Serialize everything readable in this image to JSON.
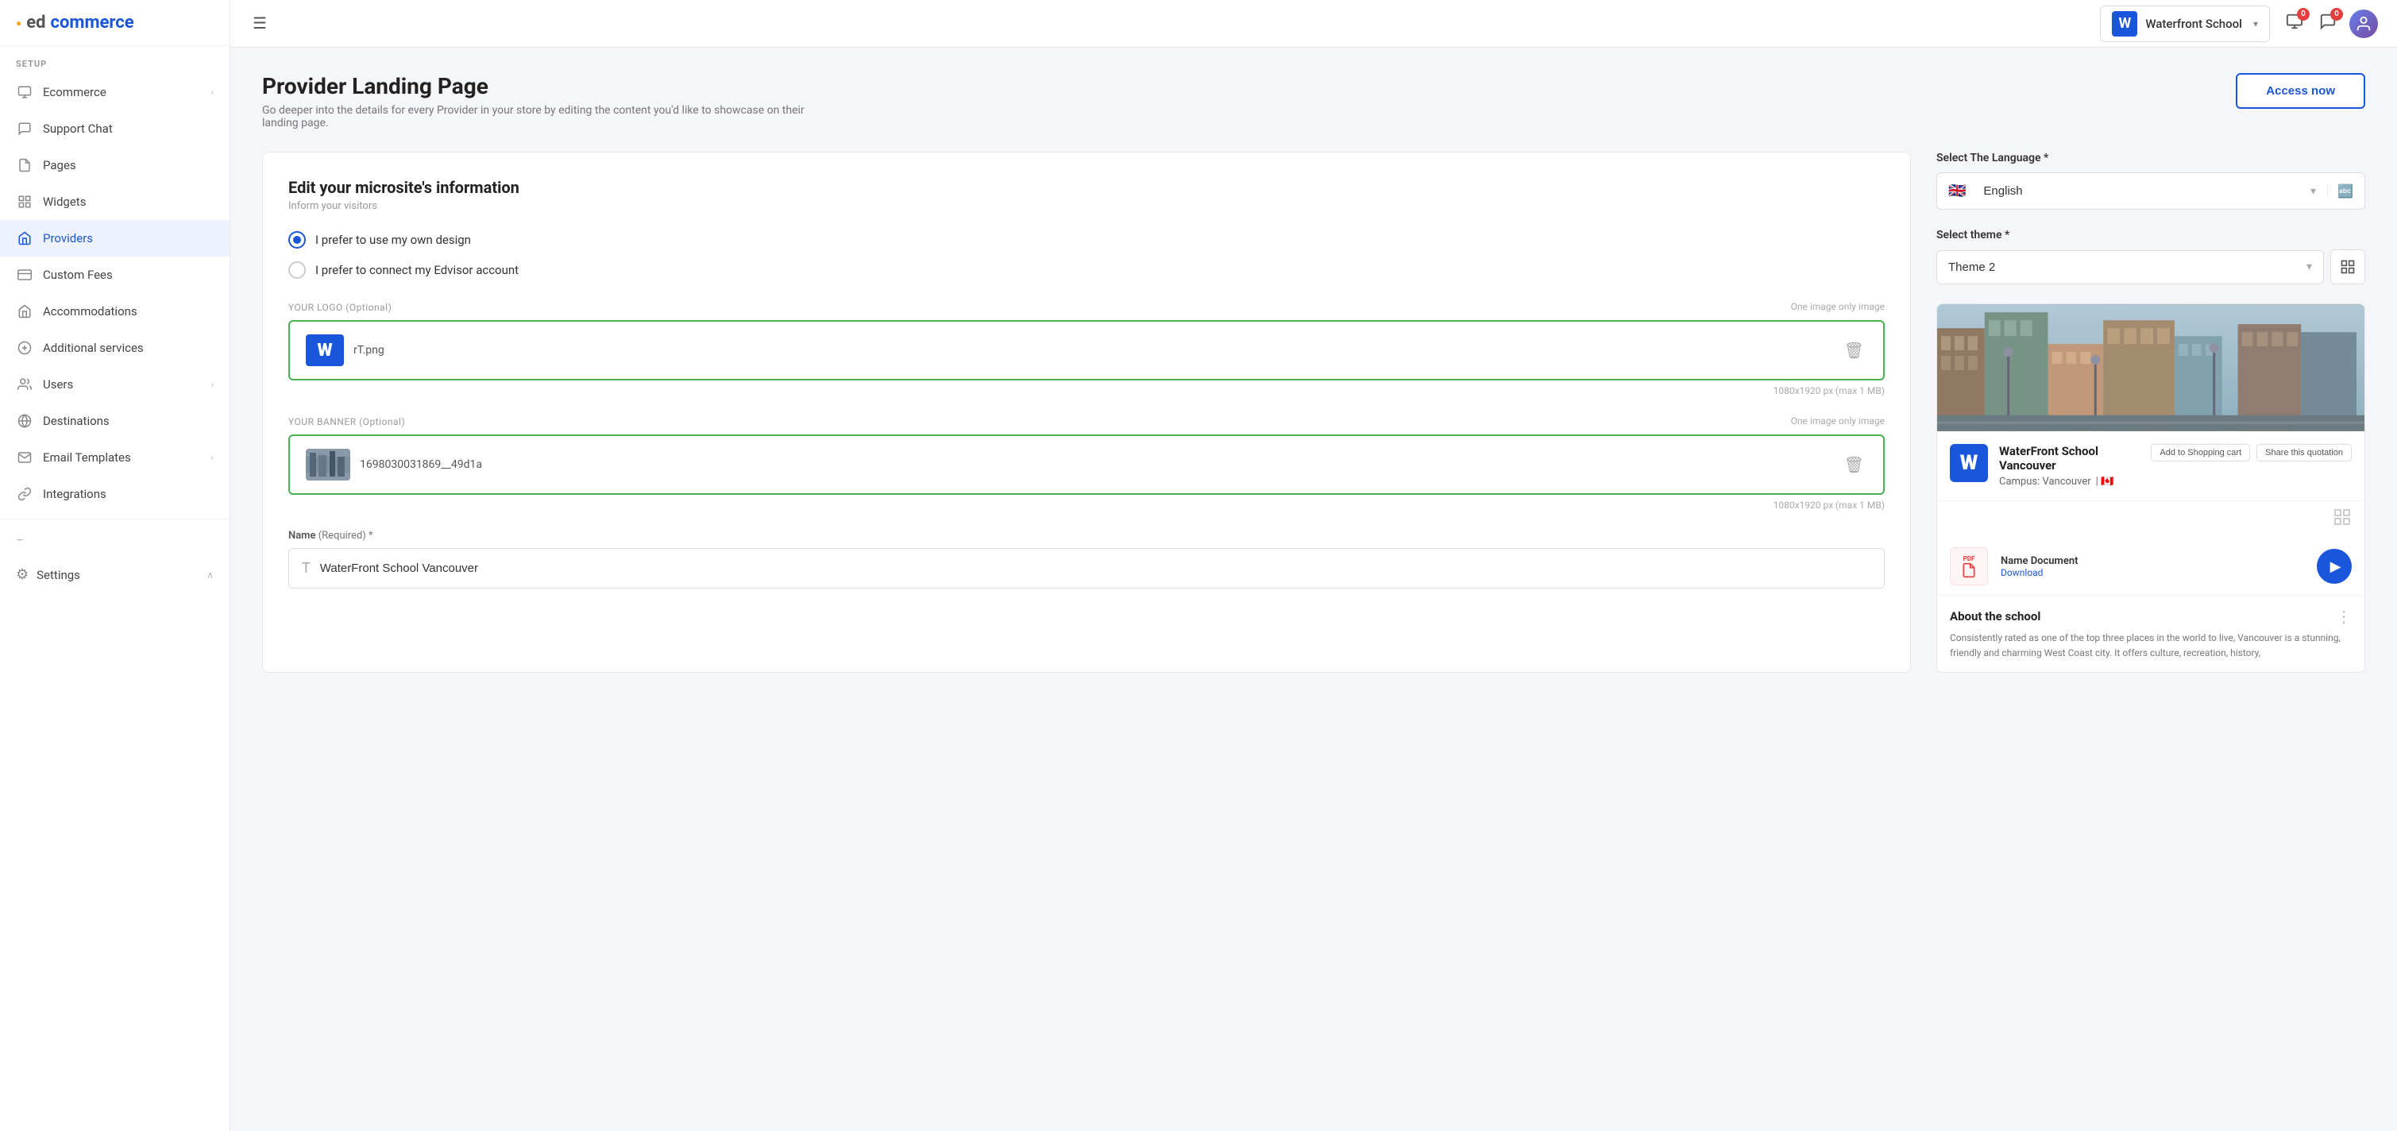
{
  "app": {
    "logo": "edcommerce",
    "logo_dot": "●"
  },
  "header": {
    "hamburger_label": "☰",
    "school_name": "Waterfront School",
    "school_initial": "W",
    "notification_count": "0",
    "chat_count": "0"
  },
  "sidebar": {
    "section_label": "SETUP",
    "items": [
      {
        "id": "ecommerce",
        "label": "Ecommerce",
        "icon": "🛒",
        "has_chevron": true
      },
      {
        "id": "support-chat",
        "label": "Support Chat",
        "icon": "💬",
        "has_chevron": false
      },
      {
        "id": "pages",
        "label": "Pages",
        "icon": "📄",
        "has_chevron": false
      },
      {
        "id": "widgets",
        "label": "Widgets",
        "icon": "🖥",
        "has_chevron": false
      },
      {
        "id": "providers",
        "label": "Providers",
        "icon": "🏢",
        "has_chevron": false
      },
      {
        "id": "custom-fees",
        "label": "Custom Fees",
        "icon": "💳",
        "has_chevron": false
      },
      {
        "id": "accommodations",
        "label": "Accommodations",
        "icon": "🏨",
        "has_chevron": false
      },
      {
        "id": "additional-services",
        "label": "Additional services",
        "icon": "➕",
        "has_chevron": false
      },
      {
        "id": "users",
        "label": "Users",
        "icon": "👥",
        "has_chevron": true
      },
      {
        "id": "destinations",
        "label": "Destinations",
        "icon": "🌐",
        "has_chevron": false
      },
      {
        "id": "email-templates",
        "label": "Email Templates",
        "icon": "✉",
        "has_chevron": true
      },
      {
        "id": "integrations",
        "label": "Integrations",
        "icon": "🔗",
        "has_chevron": false
      }
    ],
    "settings": {
      "label": "Settings",
      "icon": "⚙"
    }
  },
  "page": {
    "title": "Provider Landing Page",
    "subtitle": "Go deeper into the details for every Provider in your store by editing the content you'd like to showcase on their landing page.",
    "access_now_label": "Access now"
  },
  "form": {
    "edit_section_title": "Edit your microsite's information",
    "edit_section_subtitle": "Inform your visitors",
    "radio_options": [
      {
        "id": "own-design",
        "label": "I prefer to use my own design",
        "selected": true
      },
      {
        "id": "edvisor",
        "label": "I prefer to connect my Edvisor account",
        "selected": false
      }
    ],
    "logo_upload": {
      "label": "YOUR LOGO",
      "optional": "(Optional)",
      "hint": "One image only image",
      "filename": "rT.png",
      "size_hint": "1080x1920 px (max 1 MB)"
    },
    "banner_upload": {
      "label": "YOUR BANNER",
      "optional": "(Optional)",
      "hint": "One image only image",
      "filename": "1698030031869__49d1a",
      "size_hint": "1080x1920 px (max 1 MB)"
    },
    "name_field": {
      "label": "Name",
      "required": "(Required) *",
      "value": "WaterFront School Vancouver",
      "placeholder": "WaterFront School Vancouver"
    }
  },
  "right_panel": {
    "language_label": "Select The Language *",
    "language_value": "English",
    "language_flag": "🇬🇧",
    "theme_label": "Select theme *",
    "theme_value": "Theme 2",
    "preview": {
      "school_name": "WaterFront School Vancouver",
      "campus_label": "Campus: Vancouver",
      "add_to_cart_label": "Add to Shopping cart",
      "share_label": "Share this quotation",
      "doc_name": "Name Document",
      "doc_download": "Download",
      "about_title": "About the school",
      "about_text": "Consistently rated as one of the top three places in the world to live, Vancouver is a stunning, friendly and charming West Coast city. It offers culture, recreation, history,"
    }
  }
}
